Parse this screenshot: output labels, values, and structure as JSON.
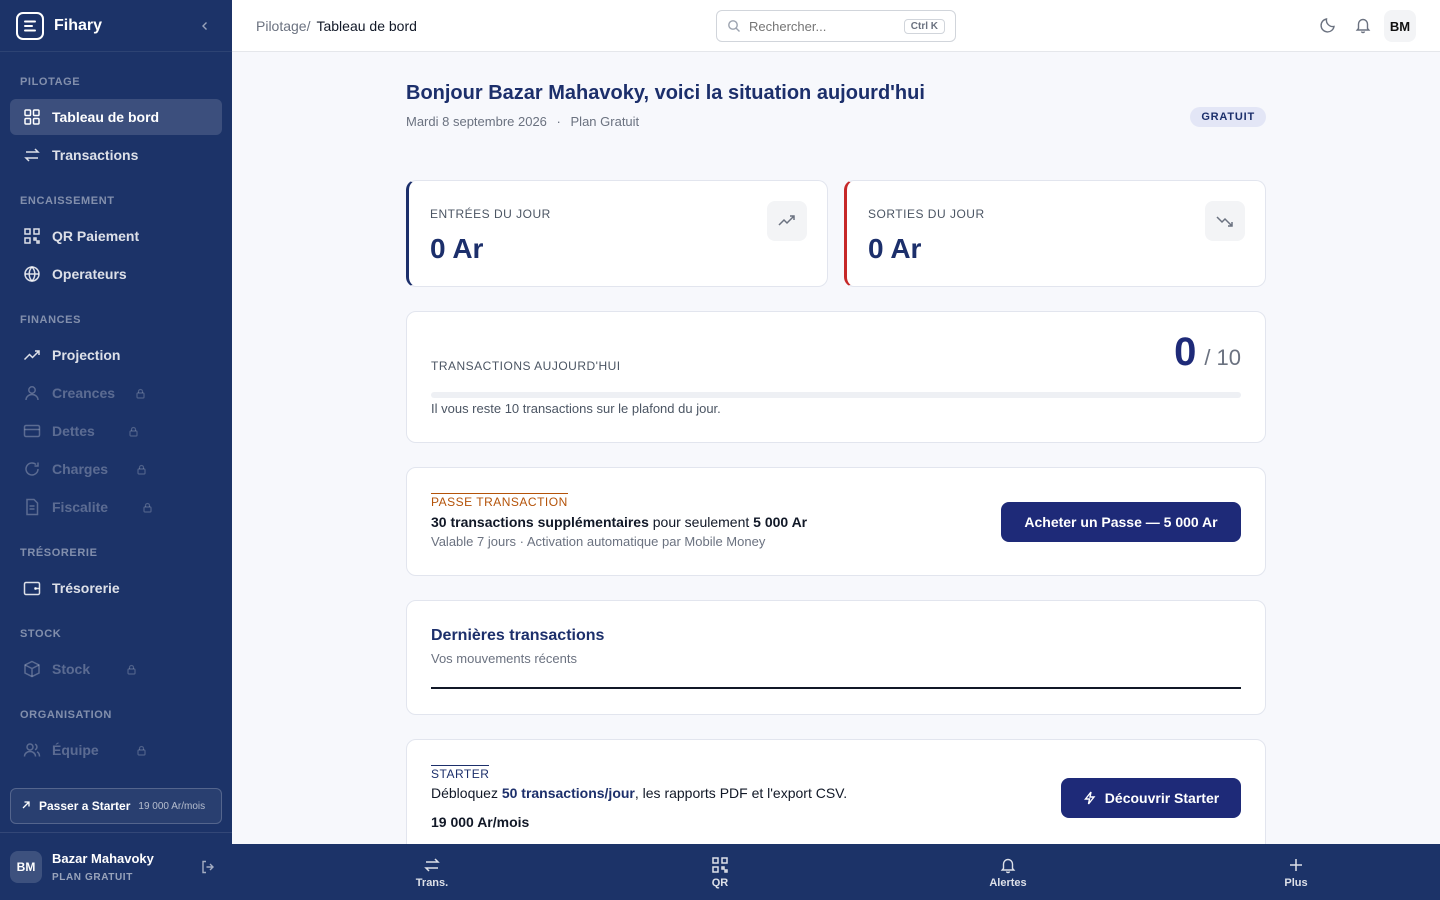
{
  "sidebar": {
    "brand": "Fihary",
    "sections": {
      "pilotage": "PILOTAGE",
      "encaissement": "ENCAISSEMENT",
      "finances": "FINANCES",
      "tresorerie": "TRÉSORERIE",
      "stock": "STOCK",
      "organisation": "ORGANISATION"
    },
    "items": {
      "dashboard": "Tableau de bord",
      "transactions": "Transactions",
      "qr": "QR Paiement",
      "operators": "Operateurs",
      "projection": "Projection",
      "creances": "Creances",
      "dettes": "Dettes",
      "charges": "Charges",
      "fiscalite": "Fiscalite",
      "tresorerie": "Trésorerie",
      "stock": "Stock",
      "equipe": "Équipe"
    },
    "upgrade": {
      "label": "Passer a Starter",
      "price": "19 000 Ar/mois"
    },
    "user": {
      "initials": "BM",
      "name": "Bazar Mahavoky",
      "plan": "PLAN GRATUIT"
    }
  },
  "topbar": {
    "breadcrumb_parent": "Pilotage/",
    "breadcrumb_current": "Tableau de bord",
    "search_placeholder": "Rechercher...",
    "search_shortcut": "Ctrl K",
    "avatar": "BM"
  },
  "main": {
    "greeting": "Bonjour Bazar Mahavoky, voici la situation aujourd'hui",
    "date": "Mardi 8 septembre 2026",
    "date_sep": "·",
    "plan": "Plan Gratuit",
    "badge": "GRATUIT",
    "income": {
      "label": "ENTRÉES DU JOUR",
      "value": "0 Ar"
    },
    "expense": {
      "label": "SORTIES DU JOUR",
      "value": "0 Ar"
    },
    "daily_tx": {
      "label": "TRANSACTIONS AUJOURD'HUI",
      "count": "0",
      "sep": "/",
      "limit": "10",
      "progress_pct": 0,
      "note": "Il vous reste 10 transactions sur le plafond du jour."
    },
    "pass": {
      "eyebrow": "PASSE TRANSACTION",
      "line_strong": "30 transactions supplémentaires",
      "line_mid": " pour seulement ",
      "line_price": "5 000 Ar",
      "detail": "Valable 7 jours · Activation automatique par Mobile Money",
      "button": "Acheter un Passe — 5 000 Ar"
    },
    "recent": {
      "title": "Dernières transactions",
      "subtitle": "Vos mouvements récents"
    },
    "starter": {
      "eyebrow": "STARTER",
      "line_a": "Débloquez ",
      "line_hl": "50 transactions/jour",
      "line_b": ", les rapports PDF et l'export CSV.",
      "price": "19 000 Ar/mois",
      "button": "Découvrir Starter"
    }
  },
  "bottom_nav": {
    "trans": "Trans.",
    "qr": "QR",
    "alerts": "Alertes",
    "more": "Plus"
  },
  "colors": {
    "sidebar_bg": "#1c3368",
    "primary": "#1e2a78",
    "income_accent": "#1c2f6b",
    "expense_accent": "#c62828",
    "pass_accent": "#b45309"
  }
}
